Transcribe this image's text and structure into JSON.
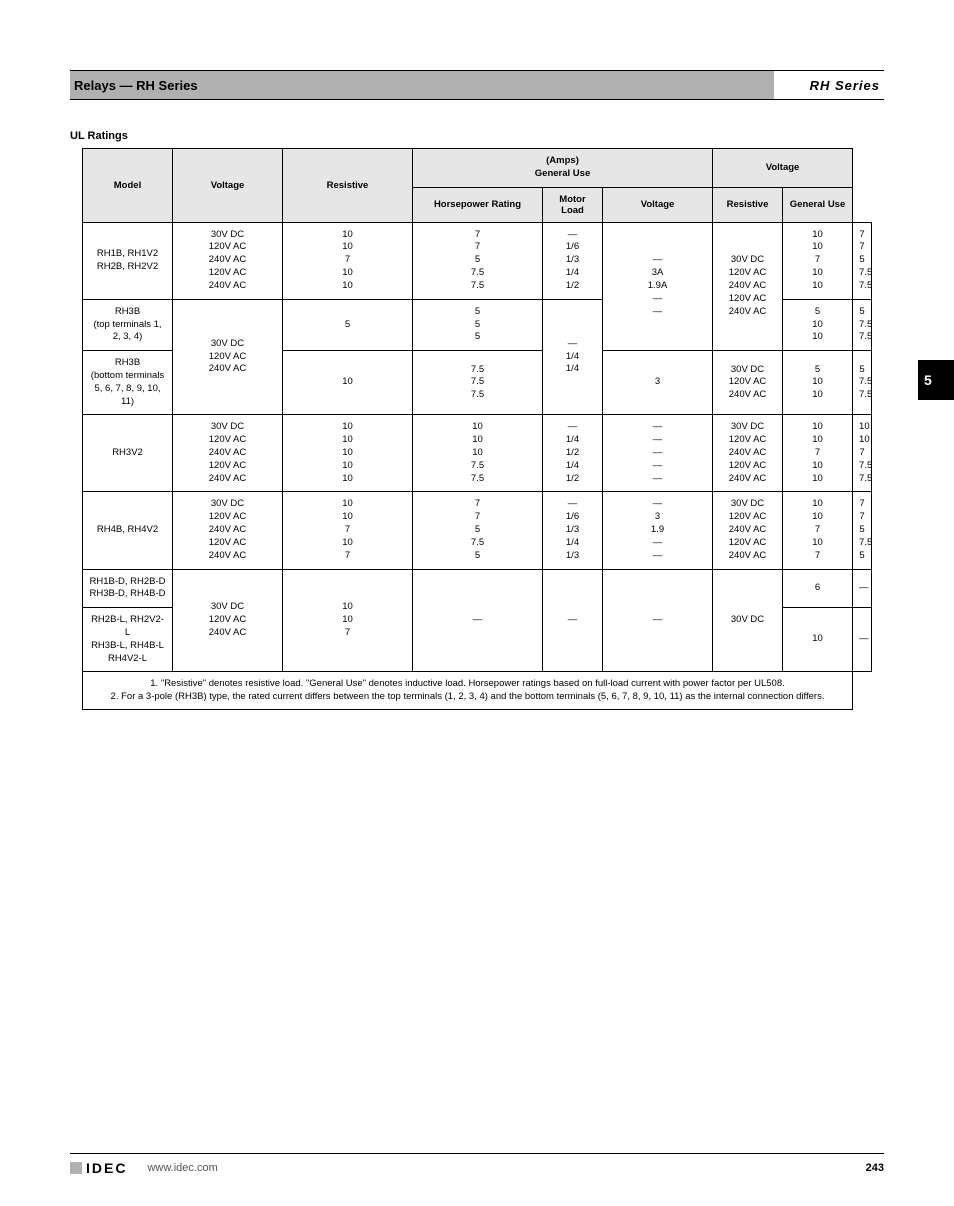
{
  "side_tab": "5",
  "header": {
    "section": "Relays",
    "series": "RH Series"
  },
  "section_title": "UL Ratings",
  "columns": {
    "model": "Model",
    "voltage": "Voltage",
    "resistive_res": "Resistive",
    "resistive_load": "(Amps)\nGeneral Use",
    "resistive_hp": "Horsepower Rating",
    "inductive_motor": "Motor Load",
    "inductive_voltage": "Voltage",
    "inductive_res": "Resistive",
    "inductive_gen": "General Use"
  },
  "row1": {
    "models": "RH1B, RH1V2\nRH2B, RH2V2",
    "voltage": "30V DC\n120V AC\n240V AC\n120V AC\n240V AC",
    "res_res": "10\n10\n7\n10\n10",
    "res_gen": "7\n7\n5\n7.5\n7.5",
    "res_hp": "—\n1/6\n1/3\n1/4\n1/2",
    "motor": "—\n3A\n1.9A\n—\n—",
    "ind_voltage": "30V DC\n120V AC\n240V AC\n120V AC\n240V AC",
    "ind_res": "10\n10\n7\n10\n10",
    "ind_gen": "7\n7\n5\n7.5\n7.5"
  },
  "row2": {
    "models_a": "RH3B\n(top terminals 1, 2, 3, 4)",
    "res_res_a": "5",
    "models_b": "RH3B\n(bottom terminals 5, 6, 7, 8, 9, 10, 11)",
    "voltage": "30V DC\n120V AC\n240V AC",
    "res_res_b": "10",
    "res_gen_a": "5\n5\n5",
    "res_gen_b": "7.5\n7.5\n7.5",
    "res_hp": "—\n1/4\n1/4",
    "motor": "3",
    "ind_voltage": "30V DC\n120V AC\n240V AC",
    "ind_res": "5\n10\n10",
    "ind_gen": "5\n7.5\n7.5"
  },
  "row3": {
    "models": "RH3V2",
    "voltage": "30V DC\n120V AC\n240V AC\n120V AC\n240V AC",
    "res_res": "10\n10\n10\n10\n10",
    "res_gen": "10\n10\n10\n7.5\n7.5",
    "res_hp": "—\n1/4\n1/2\n1/4\n1/2",
    "motor": "—\n—\n—\n—\n—",
    "ind_voltage": "30V DC\n120V AC\n240V AC\n120V AC\n240V AC",
    "ind_res": "10\n10\n7\n10\n10",
    "ind_gen": "10\n10\n7\n7.5\n7.5"
  },
  "row4": {
    "models": "RH4B, RH4V2",
    "voltage": "30V DC\n120V AC\n240V AC\n120V AC\n240V AC",
    "res_res": "10\n10\n7\n10\n7",
    "res_gen": "7\n7\n5\n7.5\n5",
    "res_hp": "—\n1/6\n1/3\n1/4\n1/3",
    "motor": "—\n3\n1.9\n—\n—",
    "ind_voltage": "30V DC\n120V AC\n240V AC\n120V AC\n240V AC",
    "ind_res": "10\n10\n7\n10\n7",
    "ind_gen": "7\n7\n5\n7.5\n5"
  },
  "row5a": {
    "models": "RH1B-D, RH2B-D\nRH3B-D, RH4B-D",
    "ind_res": "6",
    "ind_gen": "—"
  },
  "row5b": {
    "models": "RH2B-L, RH2V2-L\nRH3B-L, RH4B-L\nRH4V2-L",
    "voltage": "30V DC\n120V AC\n240V AC",
    "res_res": "10\n10\n7",
    "res_gen": "—",
    "res_hp": "—",
    "motor": "—",
    "ind_voltage": "30V DC",
    "ind_res": "10",
    "ind_gen": "—"
  },
  "notes": "1. \"Resistive\" denotes resistive load.  \"General Use\" denotes inductive load. Horsepower ratings based on full-load current with power factor per UL508.\n2. For a 3-pole (RH3B) type, the rated current differs between the top terminals (1, 2, 3, 4) and the bottom terminals (5, 6, 7, 8, 9, 10, 11) as the internal connection differs.",
  "footer": {
    "brand": "IDEC",
    "site": "www.idec.com",
    "page": "243"
  }
}
